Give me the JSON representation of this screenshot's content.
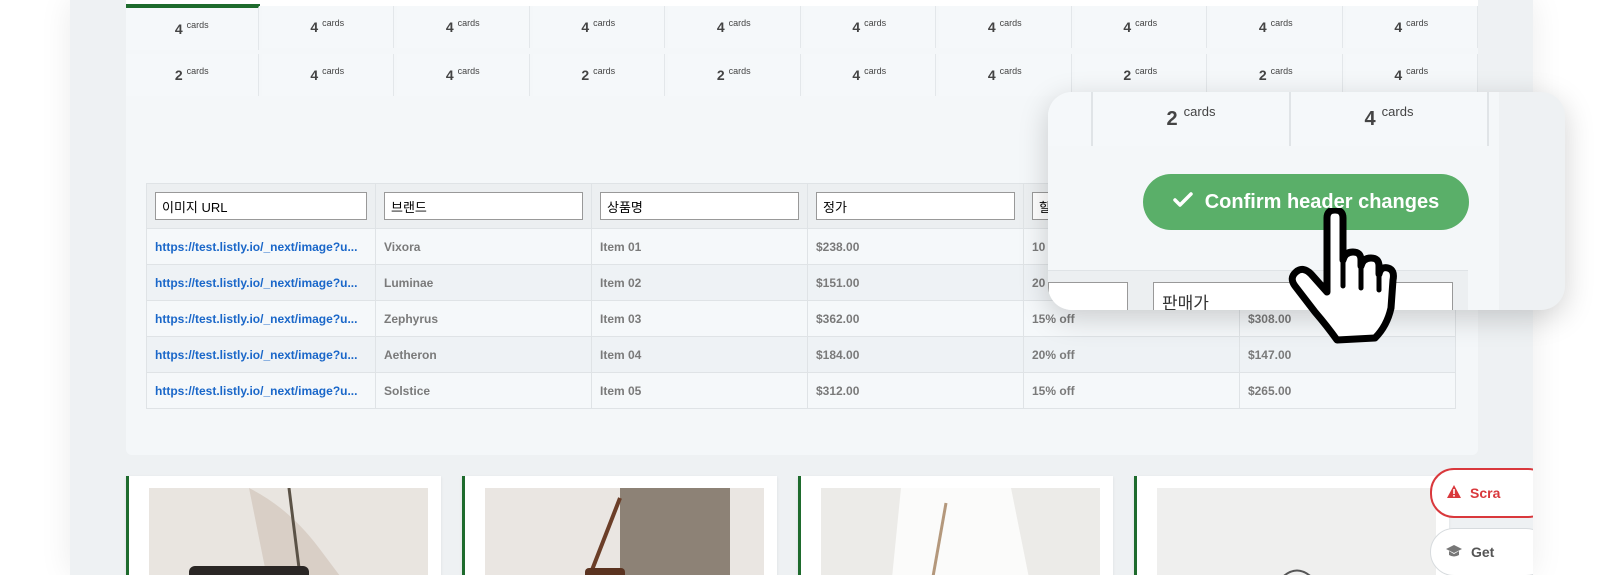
{
  "grid": {
    "unit": "cards",
    "rows": [
      [
        "4",
        "4",
        "4",
        "4",
        "4",
        "4",
        "4",
        "4",
        "4",
        "4"
      ],
      [
        "2",
        "4",
        "4",
        "2",
        "2",
        "4",
        "4",
        "2",
        "2",
        "4"
      ]
    ]
  },
  "table": {
    "headers": [
      "이미지 URL",
      "브랜드",
      "상품명",
      "정가",
      "할",
      "판매가"
    ],
    "rows": [
      [
        "https://test.listly.io/_next/image?u...",
        "Vixora",
        "Item 01",
        "$238.00",
        "10",
        ""
      ],
      [
        "https://test.listly.io/_next/image?u...",
        "Luminae",
        "Item 02",
        "$151.00",
        "20",
        ""
      ],
      [
        "https://test.listly.io/_next/image?u...",
        "Zephyrus",
        "Item 03",
        "$362.00",
        "15% off",
        "$308.00"
      ],
      [
        "https://test.listly.io/_next/image?u...",
        "Aetheron",
        "Item 04",
        "$184.00",
        "20% off",
        "$147.00"
      ],
      [
        "https://test.listly.io/_next/image?u...",
        "Solstice",
        "Item 05",
        "$312.00",
        "15% off",
        "$265.00"
      ]
    ]
  },
  "zoom": {
    "cells": [
      "2",
      "4"
    ],
    "unit": "cards",
    "confirm_label": "Confirm header changes",
    "header_value": "판매가"
  },
  "floating": {
    "scrape_label": "Scra",
    "get_label": "Get"
  },
  "colors": {
    "accent_green": "#5aaf69",
    "dark_green": "#1e6b2d",
    "link_blue": "#1a67c9",
    "scrape_red": "#d9383c"
  }
}
